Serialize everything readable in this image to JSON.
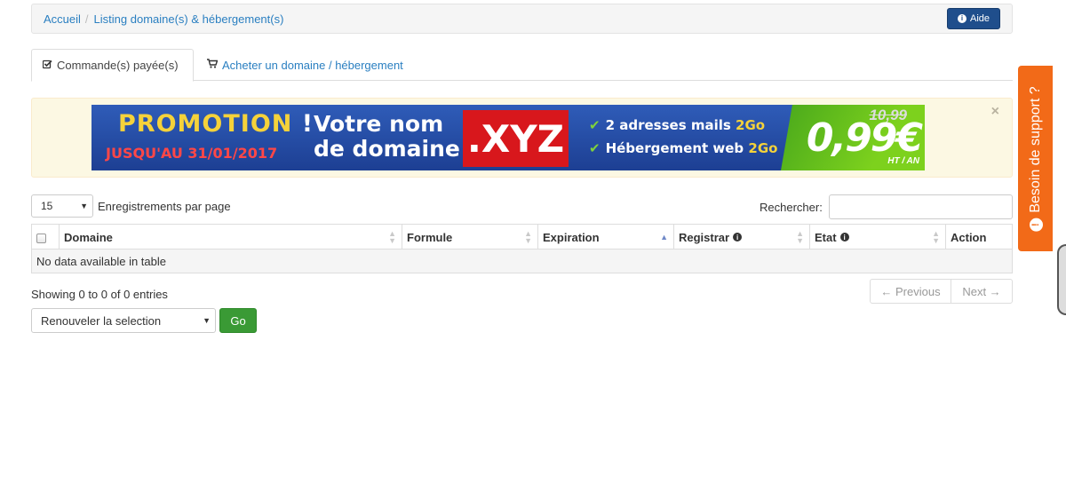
{
  "breadcrumb": {
    "home": "Accueil",
    "separator": "/",
    "current": "Listing domaine(s) & hébergement(s)"
  },
  "help_button": {
    "label": "Aide"
  },
  "tabs": [
    {
      "label": "Commande(s) payée(s)",
      "icon": "check-square-icon",
      "active": true
    },
    {
      "label": "Acheter un domaine / hébergement",
      "icon": "cart-icon",
      "active": false
    }
  ],
  "alert": {
    "close": "×",
    "banner": {
      "promo_title_part1": "PROMOTION",
      "promo_title_part2": "!",
      "promo_date": "JUSQU'AU 31/01/2017",
      "votre_line1": "Votre nom",
      "votre_line2": "de domaine",
      "tld": ".XYZ",
      "feature1_text": "2 adresses mails",
      "feature1_highlight": "2Go",
      "feature2_text": "Hébergement web",
      "feature2_highlight": "2Go",
      "old_price": "10,99",
      "price": "0,99€",
      "unit": "HT / AN"
    }
  },
  "length": {
    "value": "15",
    "label": "Enregistrements par page"
  },
  "search": {
    "label": "Rechercher:",
    "value": "",
    "placeholder": ""
  },
  "table": {
    "columns": [
      "Domaine",
      "Formule",
      "Expiration",
      "Registrar",
      "Etat",
      "Action"
    ],
    "empty_message": "No data available in table"
  },
  "info": "Showing 0 to 0 of 0 entries",
  "pagination": {
    "previous": "← Previous",
    "next": "Next →"
  },
  "bulk": {
    "selected": "Renouveler la selection",
    "go": "Go"
  },
  "support": {
    "label": "Besoin de support ?"
  },
  "colors": {
    "accent": "#2a7fc1",
    "help": "#1f4e8c",
    "go": "#3a9a35",
    "support": "#f26a18"
  }
}
